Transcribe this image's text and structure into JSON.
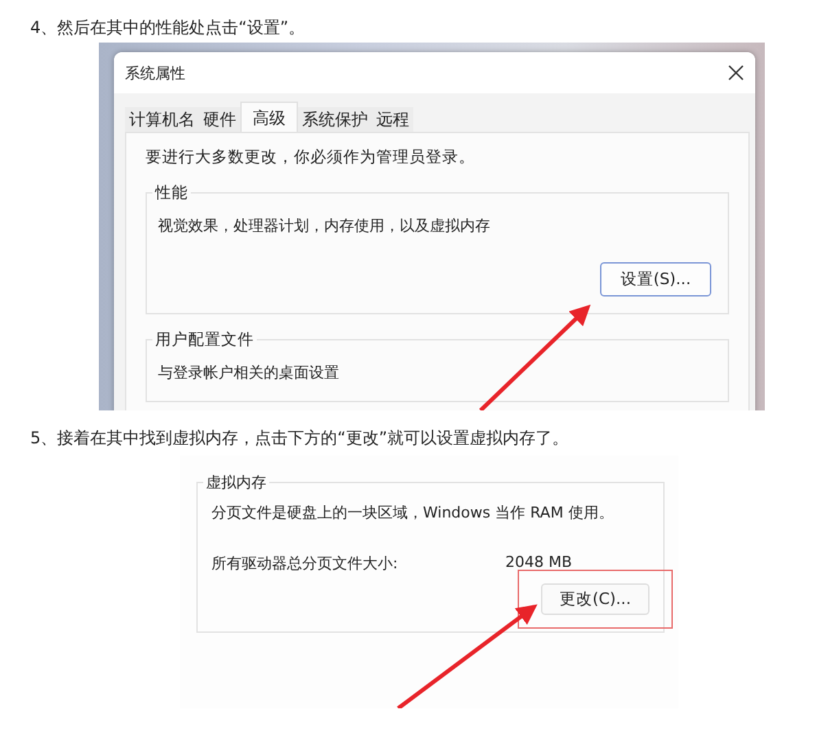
{
  "steps": [
    {
      "text": "4、然后在其中的性能处点击“设置”。",
      "screenshot": {
        "kind": "system-properties",
        "title": "系统属性",
        "tabs": [
          {
            "label": "计算机名",
            "selected": false
          },
          {
            "label": "硬件",
            "selected": false
          },
          {
            "label": "高级",
            "selected": true
          },
          {
            "label": "系统保护",
            "selected": false
          },
          {
            "label": "远程",
            "selected": false
          }
        ],
        "notice": "要进行大多数更改，你必须作为管理员登录。",
        "groups": [
          {
            "label": "性能",
            "description": "视觉效果，处理器计划，内存使用，以及虚拟内存",
            "button": "设置(S)..."
          },
          {
            "label": "用户配置文件",
            "description": "与登录帐户相关的桌面设置"
          }
        ]
      }
    },
    {
      "text": "5、接着在其中找到虚拟内存，点击下方的“更改”就可以设置虚拟内存了。",
      "screenshot": {
        "kind": "virtual-memory",
        "group": {
          "label": "虚拟内存",
          "description": "分页文件是硬盘上的一块区域，Windows 当作 RAM 使用。",
          "size_label": "所有驱动器总分页文件大小:",
          "size_value": "2048 MB",
          "button": "更改(C)...",
          "highlighted": true
        }
      }
    }
  ]
}
